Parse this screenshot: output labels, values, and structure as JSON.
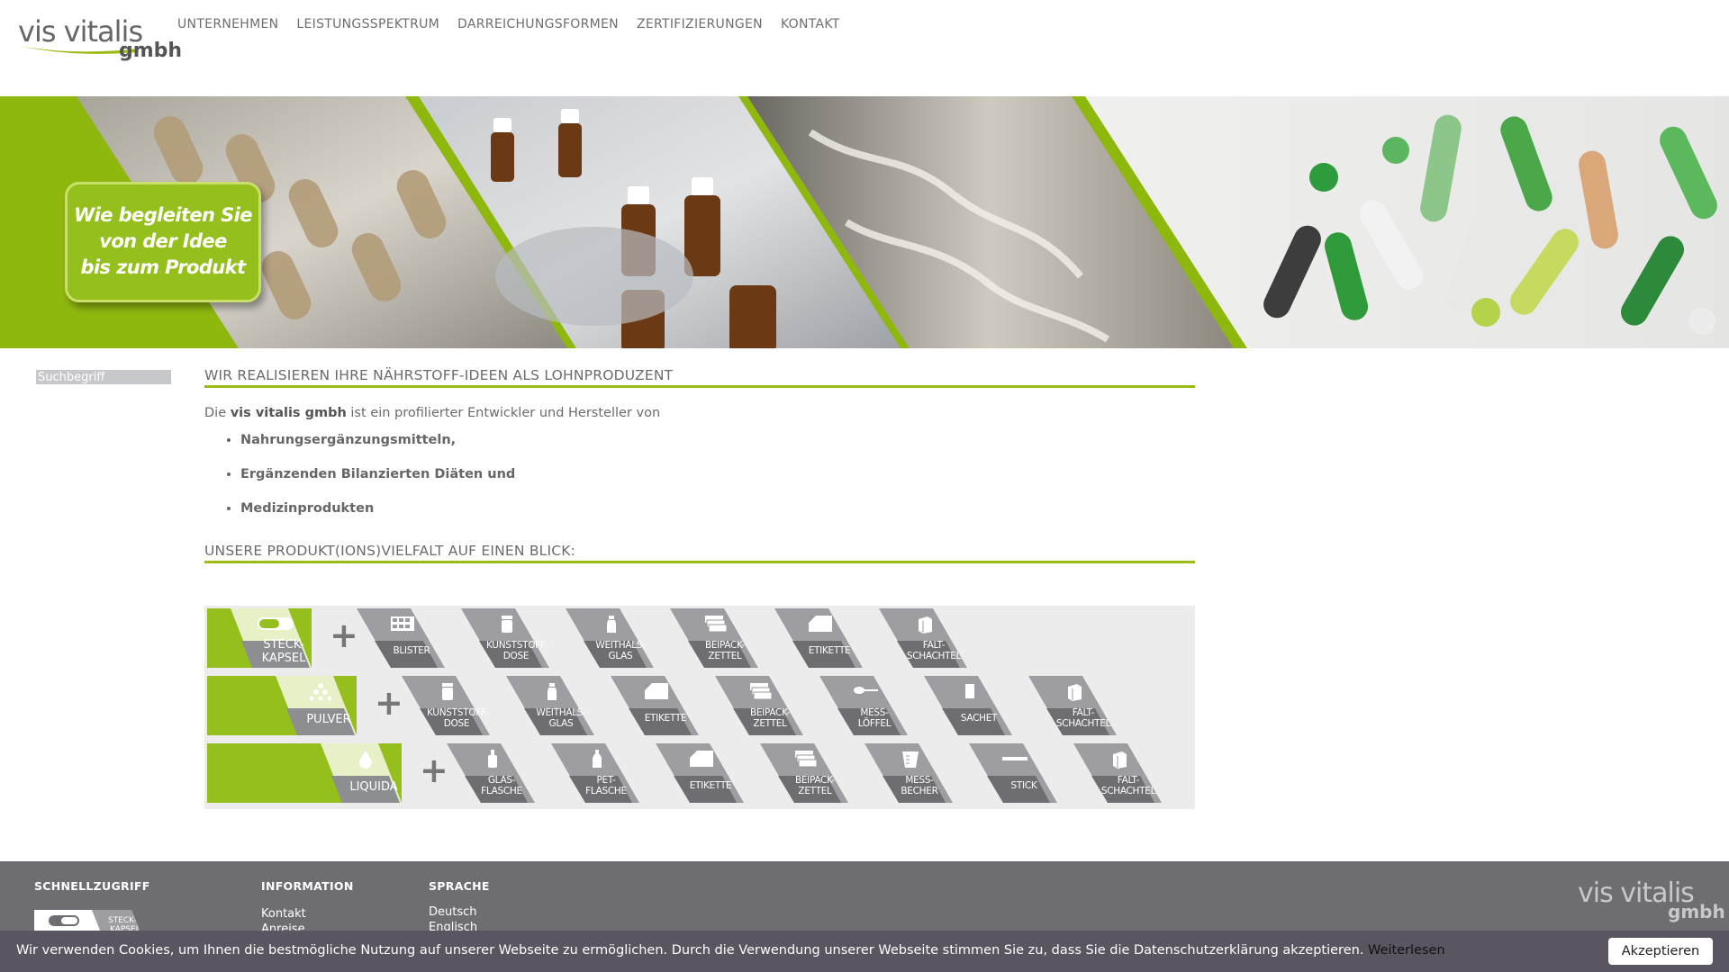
{
  "brand": {
    "name_part1": "vis vitalis",
    "name_part2": "gmbh",
    "accent_color": "#9abb13"
  },
  "nav": {
    "items": [
      "UNTERNEHMEN",
      "LEISTUNGSSPEKTRUM",
      "DARREICHUNGSFORMEN",
      "ZERTIFIZIERUNGEN",
      "KONTAKT"
    ]
  },
  "banner": {
    "slogan_lines": [
      "Wie begleiten Sie",
      "von der Idee",
      "bis zum Produkt"
    ]
  },
  "search": {
    "placeholder": "Suchbegriff"
  },
  "main": {
    "heading1": "WIR REALISIEREN IHRE NÄHRSTOFF-IDEEN ALS LOHNPRODUZENT",
    "intro_prefix": "Die ",
    "intro_bold": "vis vitalis gmbh",
    "intro_suffix": " ist ein profilierter Entwickler und Hersteller von",
    "bullets": [
      "Nahrungsergänzungsmitteln,",
      "Ergänzenden Bilanzierten Diäten und",
      "Medizinprodukten"
    ],
    "heading2": "UNSERE PRODUKT(IONS)VIELFALT AUF EINEN BLICK:"
  },
  "product_grid": {
    "rows": [
      {
        "product": [
          "STECK-",
          "KAPSEL"
        ],
        "product_icon": "capsule-icon",
        "packaging": [
          {
            "label": [
              "BLISTER"
            ],
            "icon": "blister-icon"
          },
          {
            "label": [
              "KUNSTSTOFF-",
              "DOSE"
            ],
            "icon": "plastic-jar-icon"
          },
          {
            "label": [
              "WEITHALS-",
              "GLAS"
            ],
            "icon": "wide-neck-glass-icon"
          },
          {
            "label": [
              "BEIPACK-",
              "ZETTEL"
            ],
            "icon": "leaflet-icon"
          },
          {
            "label": [
              "ETIKETTE"
            ],
            "icon": "label-icon"
          },
          {
            "label": [
              "FALT-",
              "SCHACHTEL"
            ],
            "icon": "folding-box-icon"
          }
        ]
      },
      {
        "product": [
          "PULVER"
        ],
        "product_icon": "powder-icon",
        "packaging": [
          {
            "label": [
              "KUNSTSTOFF-",
              "DOSE"
            ],
            "icon": "plastic-jar-icon"
          },
          {
            "label": [
              "WEITHALS-",
              "GLAS"
            ],
            "icon": "wide-neck-glass-icon"
          },
          {
            "label": [
              "ETIKETTE"
            ],
            "icon": "label-icon"
          },
          {
            "label": [
              "BEIPACK-",
              "ZETTEL"
            ],
            "icon": "leaflet-icon"
          },
          {
            "label": [
              "MESS-",
              "LÖFFEL"
            ],
            "icon": "measuring-spoon-icon"
          },
          {
            "label": [
              "SACHET"
            ],
            "icon": "sachet-icon"
          },
          {
            "label": [
              "FALT-",
              "SCHACHTEL"
            ],
            "icon": "folding-box-icon"
          }
        ]
      },
      {
        "product": [
          "LIQUIDA"
        ],
        "product_icon": "droplet-icon",
        "packaging": [
          {
            "label": [
              "GLAS-",
              "FLASCHE"
            ],
            "icon": "glass-bottle-icon"
          },
          {
            "label": [
              "PET-",
              "FLASCHE"
            ],
            "icon": "pet-bottle-icon"
          },
          {
            "label": [
              "ETIKETTE"
            ],
            "icon": "label-icon"
          },
          {
            "label": [
              "BEIPACK-",
              "ZETTEL"
            ],
            "icon": "leaflet-icon"
          },
          {
            "label": [
              "MESS-",
              "BECHER"
            ],
            "icon": "measuring-cup-icon"
          },
          {
            "label": [
              "STICK"
            ],
            "icon": "stick-icon"
          },
          {
            "label": [
              "FALT-",
              "SCHACHTEL"
            ],
            "icon": "folding-box-icon"
          }
        ]
      }
    ]
  },
  "footer": {
    "quick_access_title": "SCHNELLZUGRIFF",
    "quick_badge_label": "STECK-KAPSEL",
    "info_title": "INFORMATION",
    "info_links": [
      "Kontakt",
      "Anreise"
    ],
    "language_title": "SPRACHE",
    "language_links": [
      "Deutsch",
      "Englisch"
    ]
  },
  "cookie": {
    "text": "Wir verwenden Cookies, um Ihnen die bestmögliche Nutzung auf unserer Webseite zu ermöglichen. Durch die Verwendung unserer Webseite stimmen Sie zu, dass Sie die Datenschutzerklärung akzeptieren.",
    "more_label": "Weiterlesen",
    "accept_label": "Akzeptieren"
  }
}
